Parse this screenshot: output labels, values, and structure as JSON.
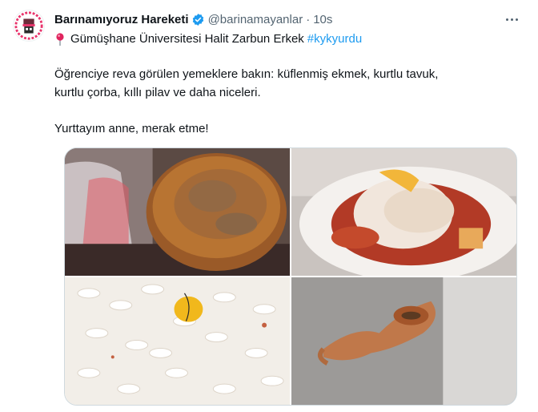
{
  "tweet": {
    "author_name": "Barınamıyoruz Hareketi",
    "handle": "@barinamayanlar",
    "separator": "·",
    "time": "10s",
    "location": "Gümüşhane Üniversitesi Halit Zarbun Erkek",
    "hashtag": "#kykyurdu",
    "line2": "Öğrenciye reva görülen yemeklere bakın: küflenmiş ekmek, kurtlu tavuk,",
    "line3": "kurtlu çorba, kıllı pilav ve daha niceleri.",
    "line4": "Yurttayım anne, merak etme!"
  },
  "icons": {
    "verified": "verified-badge-icon",
    "pin": "round-pushpin-icon",
    "more": "more-options-icon"
  },
  "colors": {
    "link": "#1d9bf0",
    "muted": "#536471",
    "text": "#0f1419",
    "verified": "#1d9bf0"
  },
  "media": {
    "photos": [
      {
        "description_name": "moldy-bread-photo"
      },
      {
        "description_name": "chicken-photo"
      },
      {
        "description_name": "rice-photo"
      },
      {
        "description_name": "soup-spoon-photo"
      }
    ]
  }
}
